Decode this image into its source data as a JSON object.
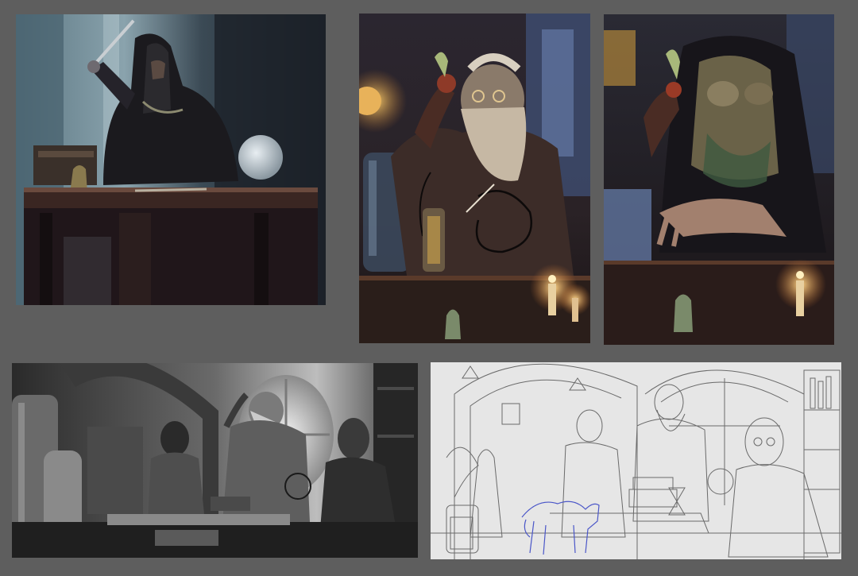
{
  "board": {
    "background": "#5e5e5e",
    "panels": [
      {
        "id": "dark-wizard-color-sketch",
        "medium": "color"
      },
      {
        "id": "bearded-wizard-color-study",
        "medium": "color"
      },
      {
        "id": "bearded-wizard-color-rough",
        "medium": "color"
      },
      {
        "id": "study-room-grayscale-value-sketch",
        "medium": "grayscale"
      },
      {
        "id": "study-room-line-drawing",
        "medium": "pencil line art"
      }
    ]
  }
}
